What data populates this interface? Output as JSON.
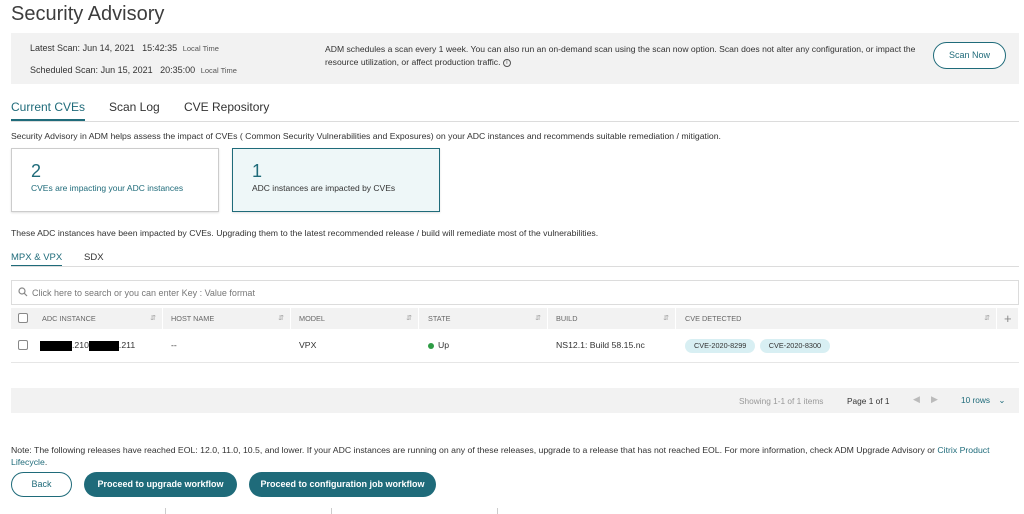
{
  "page_title": "Security Advisory",
  "scan": {
    "latest_label": "Latest Scan:",
    "latest_date": "Jun 14, 2021",
    "latest_time": "15:42:35",
    "scheduled_label": "Scheduled Scan:",
    "scheduled_date": "Jun 15, 2021",
    "scheduled_time": "20:35:00",
    "local_time": "Local Time",
    "description": "ADM schedules a scan every 1 week. You can also run an on-demand scan using the scan now option. Scan does not alter any configuration, or impact the resource utilization, or affect production traffic.",
    "scan_now_label": "Scan Now"
  },
  "tabs": [
    {
      "label": "Current CVEs",
      "active": true
    },
    {
      "label": "Scan Log",
      "active": false
    },
    {
      "label": "CVE Repository",
      "active": false
    }
  ],
  "intro_text": "Security Advisory in ADM helps assess the impact of CVEs ( Common Security Vulnerabilities and Exposures) on your ADC instances and recommends suitable remediation / mitigation.",
  "cards": [
    {
      "count": "2",
      "label": "CVEs are impacting your ADC instances"
    },
    {
      "count": "1",
      "label": "ADC instances are impacted by CVEs"
    }
  ],
  "impacted_note": "These ADC instances have been impacted by CVEs. Upgrading them to the latest recommended release / build will remediate most of the vulnerabilities.",
  "subtabs": [
    {
      "label": "MPX & VPX",
      "active": true
    },
    {
      "label": "SDX",
      "active": false
    }
  ],
  "search": {
    "placeholder": "Click here to search or you can enter Key : Value format"
  },
  "table": {
    "columns": [
      "ADC INSTANCE",
      "HOST NAME",
      "MODEL",
      "STATE",
      "BUILD",
      "CVE DETECTED"
    ],
    "rows": [
      {
        "instance_part1": ".210",
        "instance_part2": ".211",
        "host_name": "--",
        "model": "VPX",
        "state": "Up",
        "build": "NS12.1: Build 58.15.nc",
        "cves": [
          "CVE-2020-8299",
          "CVE-2020-8300"
        ]
      }
    ]
  },
  "pager": {
    "showing": "Showing 1-1 of 1 items",
    "page_label": "Page",
    "page_value": "1 of 1",
    "rows_label": "10 rows"
  },
  "eol_note": {
    "text": "Note: The following releases have reached EOL: 12.0, 11.0, 10.5, and lower. If your ADC instances are running on any of these releases, upgrade to a release that has not reached EOL. For more information, check ADM Upgrade Advisory or ",
    "link": "Citrix Product Lifecycle",
    "end": "."
  },
  "buttons": {
    "back": "Back",
    "upgrade": "Proceed to upgrade workflow",
    "config": "Proceed to configuration job workflow"
  },
  "colors": {
    "accent": "#1f6b7a",
    "status_up": "#2e9c45",
    "cve_pill": "#d8eff3"
  }
}
